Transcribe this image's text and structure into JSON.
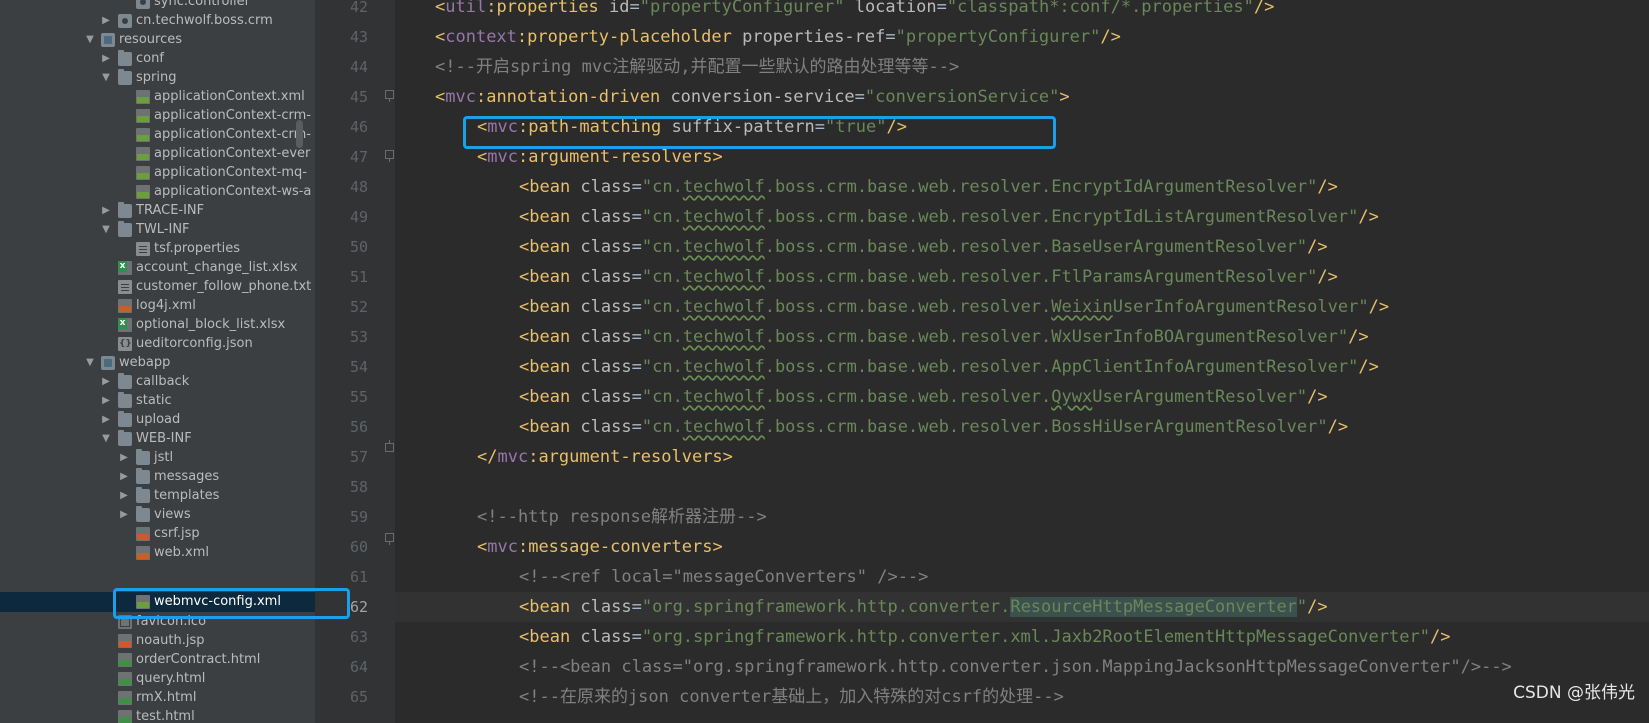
{
  "project_tree": {
    "items": [
      {
        "label": "sync.controller",
        "icon": "package-icon"
      },
      {
        "label": "cn.techwolf.boss.crm",
        "icon": "package-icon"
      },
      {
        "label": "resources",
        "icon": "resources-folder-icon"
      },
      {
        "label": "conf",
        "icon": "folder-icon"
      },
      {
        "label": "spring",
        "icon": "folder-icon"
      },
      {
        "label": "applicationContext.xml",
        "icon": "spring-xml-icon"
      },
      {
        "label": "applicationContext-crm-",
        "icon": "spring-xml-icon"
      },
      {
        "label": "applicationContext-crm-",
        "icon": "spring-xml-icon"
      },
      {
        "label": "applicationContext-ever",
        "icon": "spring-xml-icon"
      },
      {
        "label": "applicationContext-mq-",
        "icon": "spring-xml-icon"
      },
      {
        "label": "applicationContext-ws-a",
        "icon": "spring-xml-icon"
      },
      {
        "label": "TRACE-INF",
        "icon": "folder-icon"
      },
      {
        "label": "TWL-INF",
        "icon": "folder-icon"
      },
      {
        "label": "tsf.properties",
        "icon": "properties-file-icon"
      },
      {
        "label": "account_change_list.xlsx",
        "icon": "excel-file-icon"
      },
      {
        "label": "customer_follow_phone.txt",
        "icon": "text-file-icon"
      },
      {
        "label": "log4j.xml",
        "icon": "xml-file-icon"
      },
      {
        "label": "optional_block_list.xlsx",
        "icon": "excel-file-icon"
      },
      {
        "label": "ueditorconfig.json",
        "icon": "json-file-icon"
      },
      {
        "label": "webapp",
        "icon": "resources-folder-icon"
      },
      {
        "label": "callback",
        "icon": "folder-icon"
      },
      {
        "label": "static",
        "icon": "folder-icon"
      },
      {
        "label": "upload",
        "icon": "folder-icon"
      },
      {
        "label": "WEB-INF",
        "icon": "folder-icon"
      },
      {
        "label": "jstl",
        "icon": "folder-icon"
      },
      {
        "label": "messages",
        "icon": "folder-icon"
      },
      {
        "label": "templates",
        "icon": "folder-icon"
      },
      {
        "label": "views",
        "icon": "folder-icon"
      },
      {
        "label": "csrf.jsp",
        "icon": "jsp-file-icon"
      },
      {
        "label": "web.xml",
        "icon": "xml-file-icon"
      },
      {
        "label": "webmvc-config.xml",
        "icon": "spring-xml-icon",
        "selected": true
      },
      {
        "label": "favicon.ico",
        "icon": "image-file-icon"
      },
      {
        "label": "noauth.jsp",
        "icon": "jsp-file-icon"
      },
      {
        "label": "orderContract.html",
        "icon": "html-file-icon"
      },
      {
        "label": "query.html",
        "icon": "html-file-icon"
      },
      {
        "label": "rmX.html",
        "icon": "html-file-icon"
      },
      {
        "label": "test.html",
        "icon": "html-file-icon"
      }
    ]
  },
  "editor": {
    "current_line": "62",
    "line_numbers": [
      "42",
      "43",
      "44",
      "45",
      "46",
      "47",
      "48",
      "49",
      "50",
      "51",
      "52",
      "53",
      "54",
      "55",
      "56",
      "57",
      "58",
      "59",
      "60",
      "61",
      "62",
      "63",
      "64",
      "65"
    ],
    "lines": {
      "l42": {
        "tag_open": "<",
        "ns": "util",
        "tag_rest": ":properties",
        "a1": " id",
        "eq1": "=",
        "v1": "\"propertyConfigurer\"",
        "a2": " location",
        "eq2": "=",
        "v2": "\"classpath*:conf/*.properties\"",
        "close": "/>"
      },
      "l43": {
        "tag_open": "<",
        "ns": "context",
        "tag_rest": ":property-placeholder",
        "a1": " properties-ref",
        "eq1": "=",
        "v1": "\"propertyConfigurer\"",
        "close": "/>"
      },
      "l44": {
        "comment": "<!--开启spring mvc注解驱动,并配置一些默认的路由处理等等-->"
      },
      "l45": {
        "tag_open": "<",
        "ns": "mvc",
        "tag_rest": ":annotation-driven",
        "a1": " conversion-service",
        "eq1": "=",
        "v1": "\"conversionService\"",
        "close": ">"
      },
      "l46": {
        "tag_open": "<",
        "ns": "mvc",
        "tag_rest": ":path-matching",
        "a1": " suffix-pattern",
        "eq1": "=",
        "v1": "\"true\"",
        "close": "/>"
      },
      "l47": {
        "tag_open": "<",
        "ns": "mvc",
        "tag_rest": ":argument-resolvers",
        "close": ">"
      },
      "l48": {
        "tag": "<bean",
        "attr": " class",
        "eq": "=",
        "v_pre": "\"cn.",
        "v_squig": "techwolf",
        "v_mid": ".boss.crm.base.web.resolver.",
        "v_squig2": "",
        "v_post": "EncryptIdArgumentResolver\"",
        "close": "/>"
      },
      "l49": {
        "tag": "<bean",
        "attr": " class",
        "eq": "=",
        "v_pre": "\"cn.",
        "v_squig": "techwolf",
        "v_mid": ".boss.crm.base.web.resolver.",
        "v_squig2": "",
        "v_post": "EncryptIdListArgumentResolver\"",
        "close": "/>"
      },
      "l50": {
        "tag": "<bean",
        "attr": " class",
        "eq": "=",
        "v_pre": "\"cn.",
        "v_squig": "techwolf",
        "v_mid": ".boss.crm.base.web.resolver.",
        "v_squig2": "",
        "v_post": "BaseUserArgumentResolver\"",
        "close": "/>"
      },
      "l51": {
        "tag": "<bean",
        "attr": " class",
        "eq": "=",
        "v_pre": "\"cn.",
        "v_squig": "techwolf",
        "v_mid": ".boss.crm.base.web.resolver.",
        "v_squig2": "",
        "v_post": "FtlParamsArgumentResolver\"",
        "close": "/>"
      },
      "l52": {
        "tag": "<bean",
        "attr": " class",
        "eq": "=",
        "v_pre": "\"cn.",
        "v_squig": "techwolf",
        "v_mid": ".boss.crm.base.web.resolver.",
        "v_squig2": "Weixin",
        "v_post": "UserInfoArgumentResolver\"",
        "close": "/>"
      },
      "l53": {
        "tag": "<bean",
        "attr": " class",
        "eq": "=",
        "v_pre": "\"cn.",
        "v_squig": "techwolf",
        "v_mid": ".boss.crm.base.web.resolver.",
        "v_squig2": "",
        "v_post": "WxUserInfoBOArgumentResolver\"",
        "close": "/>"
      },
      "l54": {
        "tag": "<bean",
        "attr": " class",
        "eq": "=",
        "v_pre": "\"cn.",
        "v_squig": "techwolf",
        "v_mid": ".boss.crm.base.web.resolver.",
        "v_squig2": "",
        "v_post": "AppClientInfoArgumentResolver\"",
        "close": "/>"
      },
      "l55": {
        "tag": "<bean",
        "attr": " class",
        "eq": "=",
        "v_pre": "\"cn.",
        "v_squig": "techwolf",
        "v_mid": ".boss.crm.base.web.resolver.",
        "v_squig2": "Qywx",
        "v_post": "UserArgumentResolver\"",
        "close": "/>"
      },
      "l56": {
        "tag": "<bean",
        "attr": " class",
        "eq": "=",
        "v_pre": "\"cn.",
        "v_squig": "techwolf",
        "v_mid": ".boss.crm.base.web.resolver.",
        "v_squig2": "",
        "v_post": "BossHiUserArgumentResolver\"",
        "close": "/>"
      },
      "l57": {
        "tag_open": "</",
        "ns": "mvc",
        "tag_rest": ":argument-resolvers",
        "close": ">"
      },
      "l59": {
        "comment": "<!--http response解析器注册-->"
      },
      "l60": {
        "tag_open": "<",
        "ns": "mvc",
        "tag_rest": ":message-converters",
        "close": ">"
      },
      "l61": {
        "comment": "<!--<ref local=\"messageConverters\" />-->"
      },
      "l62": {
        "tag": "<bean",
        "attr": " class",
        "eq": "=",
        "v_pre": "\"org.springframework.http.converter.",
        "v_hl1": "ResourceHttpMess",
        "v_hl2": "ageConverter",
        "v_post": "\"",
        "close": "/>"
      },
      "l63": {
        "tag": "<bean",
        "attr": " class",
        "eq": "=",
        "v": "\"org.springframework.http.converter.xml.Jaxb2RootElementHttpMessageConverter\"",
        "close": "/>"
      },
      "l64": {
        "comment": "<!--<bean class=\"org.springframework.http.converter.json.MappingJacksonHttpMessageConverter\"/>-->"
      },
      "l65": {
        "comment": "<!--在原来的json converter基础上，加入特殊的对csrf的处理-->"
      }
    }
  },
  "watermark": "CSDN @张伟光",
  "colors": {
    "annotation_box": "#1a9fe8",
    "tag": "#e8bf6a",
    "string": "#6a8759",
    "comment": "#808080",
    "namespace": "#9876aa"
  }
}
